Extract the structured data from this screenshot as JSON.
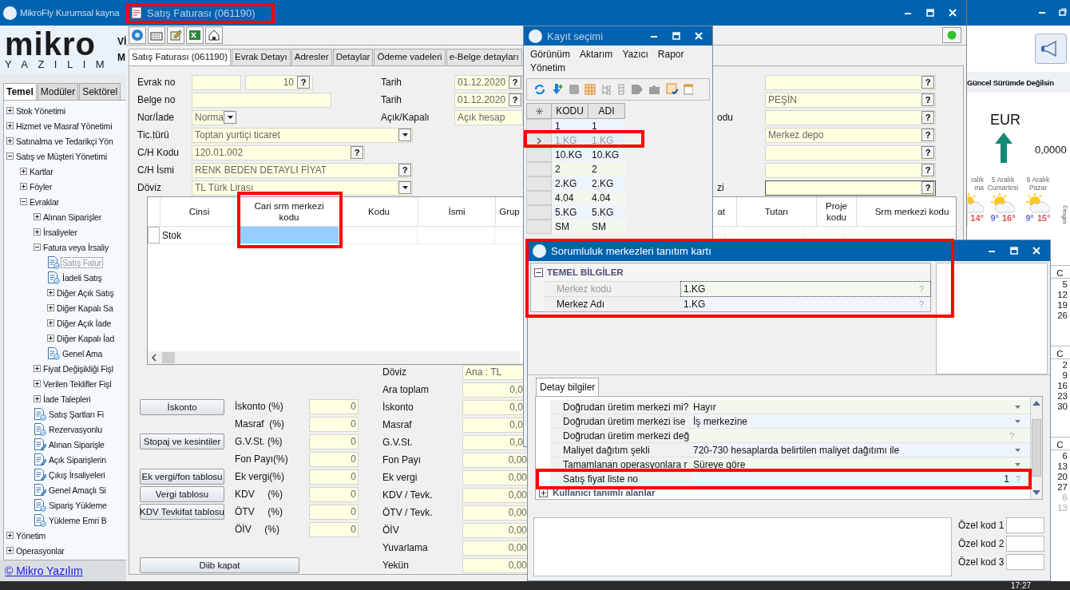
{
  "app": {
    "title": "MikroFly Kurumsal kayna",
    "logo": "mikro",
    "logo_sub": "YAZILIM",
    "logo_side": [
      "Vİ",
      "M"
    ],
    "footer_link": "© Mikro Yazılım"
  },
  "left_tabs": [
    {
      "label": "Temel",
      "selected": true
    },
    {
      "label": "Modüler",
      "selected": false
    },
    {
      "label": "Sektörel",
      "selected": false
    }
  ],
  "tree": [
    {
      "label": "Stok Yönetimi",
      "kind": "folder",
      "expanded": false,
      "selected": false
    },
    {
      "label": "Hizmet ve Masraf Yönetimi",
      "kind": "folder",
      "expanded": false,
      "selected": false
    },
    {
      "label": "Satınalma ve Tedarikçi Yön",
      "kind": "folder",
      "expanded": false,
      "selected": false
    },
    {
      "label": "Satış ve Müşteri Yönetimi",
      "kind": "folder",
      "expanded": true,
      "selected": false,
      "children": [
        {
          "label": "Kartlar",
          "kind": "folder",
          "expanded": false,
          "selected": false
        },
        {
          "label": "Föyler",
          "kind": "folder",
          "expanded": false,
          "selected": false
        },
        {
          "label": "Evraklar",
          "kind": "folder",
          "expanded": true,
          "selected": false,
          "children": [
            {
              "label": "Alınan Siparişler",
              "kind": "folder",
              "expanded": false,
              "selected": false
            },
            {
              "label": "İrsaliyeler",
              "kind": "folder",
              "expanded": false,
              "selected": false
            },
            {
              "label": "Fatura veya İrsaliy",
              "kind": "folder",
              "expanded": true,
              "selected": false,
              "children": [
                {
                  "label": "Satış Fatur",
                  "kind": "doc",
                  "selected": true
                },
                {
                  "label": "İadeli Satış",
                  "kind": "doc",
                  "selected": false
                },
                {
                  "label": "Diğer Açık Satış",
                  "kind": "folder",
                  "expanded": false,
                  "selected": false
                },
                {
                  "label": "Diğer Kapalı Sa",
                  "kind": "folder",
                  "expanded": false,
                  "selected": false
                },
                {
                  "label": "Diğer Açık İade",
                  "kind": "folder",
                  "expanded": false,
                  "selected": false
                },
                {
                  "label": "Diğer Kapalı İad",
                  "kind": "folder",
                  "expanded": false,
                  "selected": false
                },
                {
                  "label": "Genel Ama",
                  "kind": "doc",
                  "selected": false
                }
              ]
            },
            {
              "label": "Fiyat Değişikliği Fişl",
              "kind": "folder",
              "expanded": false,
              "selected": false
            },
            {
              "label": "Verilen Teklifler Fişl",
              "kind": "folder",
              "expanded": false,
              "selected": false
            },
            {
              "label": "İade Talepleri",
              "kind": "folder",
              "expanded": false,
              "selected": false
            },
            {
              "label": "Satış Şartları Fi",
              "kind": "doc",
              "selected": false
            },
            {
              "label": "Rezervasyonlu",
              "kind": "doc",
              "selected": false
            },
            {
              "label": "Alınan Siparişle",
              "kind": "doc-edit",
              "selected": false
            },
            {
              "label": "Açık Siparişlerin",
              "kind": "doc-edit",
              "selected": false
            },
            {
              "label": "Çıkış İrsaliyeleri",
              "kind": "doc-edit",
              "selected": false
            },
            {
              "label": "Genel Amaçlı Si",
              "kind": "doc-edit",
              "selected": false
            },
            {
              "label": "Sipariş Yükleme",
              "kind": "doc",
              "selected": false
            },
            {
              "label": "Yükleme Emri B",
              "kind": "doc",
              "selected": false
            }
          ]
        }
      ]
    },
    {
      "label": "Yönetim",
      "kind": "folder",
      "expanded": false,
      "selected": false
    },
    {
      "label": "Operasyonlar",
      "kind": "folder",
      "expanded": false,
      "selected": false
    }
  ],
  "invoice_window": {
    "title": "Satış Faturası (061190)",
    "tabs": [
      {
        "label": "Satış Faturası (061190)",
        "selected": true
      },
      {
        "label": "Evrak Detayı",
        "selected": false
      },
      {
        "label": "Adresler",
        "selected": false
      },
      {
        "label": "Detaylar",
        "selected": false
      },
      {
        "label": "Ödeme vadeleri",
        "selected": false
      },
      {
        "label": "e-Belge detayları",
        "selected": false
      }
    ],
    "fields_left": [
      {
        "label": "Evrak no",
        "kind": "serial",
        "value": "10",
        "button": "?"
      },
      {
        "label": "Belge no",
        "kind": "text"
      },
      {
        "label": "Nor/İade",
        "kind": "combo",
        "value": "Norma"
      },
      {
        "label": "Tic.türü",
        "kind": "combo",
        "value": "Toptan yurtiçi ticaret"
      },
      {
        "label": "C/H Kodu",
        "kind": "lookup",
        "value": "120.01.002",
        "button": "?"
      },
      {
        "label": "C/H İsmi",
        "kind": "lookup",
        "value": "RENK BEDEN DETAYLI FİYAT",
        "button": "?"
      },
      {
        "label": "Döviz",
        "kind": "combo",
        "value": "TL  Türk Lirası"
      }
    ],
    "fields_mid": [
      {
        "label": "Tarih",
        "kind": "lookup",
        "value": "01.12.2020",
        "button": "?"
      },
      {
        "label": "Tarih",
        "kind": "lookup",
        "value": "01.12.2020",
        "button": "?"
      },
      {
        "label": "Açık/Kapalı",
        "kind": "text",
        "value": "Açık hesap"
      }
    ],
    "fields_right": [
      {
        "kind": "lookup",
        "button": "?"
      },
      {
        "kind": "lookup",
        "value": "PEŞİN",
        "button": "?"
      },
      {
        "kind": "lookup",
        "label": "odu",
        "button": "?"
      },
      {
        "kind": "lookup",
        "value": "Merkez depo",
        "button": "?"
      },
      {
        "kind": "lookup",
        "button": "?"
      },
      {
        "kind": "lookup",
        "button": "?"
      },
      {
        "kind": "lookup",
        "label": "zi",
        "button": "?"
      }
    ],
    "grid": {
      "columns": [
        "Cinsi",
        "Cari srm merkezi kodu",
        "Kodu",
        "İsmi",
        "Grup",
        "at",
        "Tutarı",
        "Proje kodu",
        "Srm merkezi kodu"
      ],
      "rows": [
        {
          "cells": [
            {
              "text": "Stok",
              "selected": false
            },
            {
              "selected": true
            }
          ]
        }
      ]
    },
    "buttons": [
      "İskonto",
      "Stopaj ve kesintiler",
      "Ek vergi/fon tablosu",
      "Vergi tablosu",
      "KDV Tevkifat tablosu",
      "Diib kapat"
    ],
    "rates": [
      {
        "label": "İskonto (%)",
        "value": "0"
      },
      {
        "label": "Masraf  (%)",
        "value": "0"
      },
      {
        "label": "G.V.St. (%)",
        "value": "0"
      },
      {
        "label": "Fon Payı(%)",
        "value": "0"
      },
      {
        "label": "Ek vergi(%)",
        "value": "0"
      },
      {
        "label": "KDV     (%)",
        "value": "0"
      },
      {
        "label": "ÖTV     (%)",
        "value": "0"
      },
      {
        "label": "ÖİV     (%)",
        "value": "0"
      }
    ],
    "totals": [
      {
        "label": "Döviz",
        "kind": "text",
        "value": "Ana : TL"
      },
      {
        "label": "Ara toplam",
        "kind": "amount",
        "value": "0,0"
      },
      {
        "label": "İskonto",
        "kind": "amount",
        "value": "0,0"
      },
      {
        "label": "Masraf",
        "kind": "amount",
        "value": "0,0"
      },
      {
        "label": "G.V.St.",
        "kind": "amount",
        "value": "0,0"
      },
      {
        "label": "Fon Payı",
        "kind": "amount",
        "value": "0,00"
      },
      {
        "label": "Ek vergi",
        "kind": "amount",
        "value": "0,00"
      },
      {
        "label": "KDV / Tevk.",
        "kind": "amount",
        "value": "0,00"
      },
      {
        "label": "ÖTV / Tevk.",
        "kind": "amount",
        "value": "0,00"
      },
      {
        "label": "ÖİV",
        "kind": "amount",
        "value": "0,00"
      },
      {
        "label": "Yuvarlama",
        "kind": "amount",
        "value": "0,00"
      },
      {
        "label": "Yekün",
        "kind": "amount",
        "value": "0,00"
      }
    ]
  },
  "record_window": {
    "title": "Kayıt seçimi",
    "menu": [
      "Görünüm",
      "Aktarım",
      "Yazıcı",
      "Rapor",
      "Yönetim"
    ],
    "columns": [
      "KODU",
      "ADI"
    ],
    "rows": [
      {
        "code": "1",
        "name": "1",
        "selected": false
      },
      {
        "code": "1.KG",
        "name": "1.KG",
        "selected": true
      },
      {
        "code": "10.KG",
        "name": "10.KG",
        "selected": false
      },
      {
        "code": "2",
        "name": "2",
        "selected": false
      },
      {
        "code": "2.KG",
        "name": "2.KG",
        "selected": false
      },
      {
        "code": "4.04",
        "name": "4.04",
        "selected": false
      },
      {
        "code": "5.KG",
        "name": "5.KG",
        "selected": false
      },
      {
        "code": "SM",
        "name": "SM",
        "selected": false
      }
    ]
  },
  "center_window": {
    "title": "Sorumluluk merkezleri tanıtım kartı",
    "section": {
      "label": "TEMEL BİLGİLER",
      "expanded": true
    },
    "fields": [
      {
        "label": "Merkez kodu",
        "value": "1.KG",
        "button": "?",
        "disabled": true
      },
      {
        "label": "Merkez Adı",
        "value": "1.KG",
        "button": "?",
        "disabled": false
      }
    ],
    "detail_tab": "Detay bilgiler",
    "properties": [
      {
        "label": "Doğrudan üretim merkezi mi?",
        "kind": "combo",
        "value": "Hayır"
      },
      {
        "label": "Doğrudan üretim merkezi ise",
        "kind": "combo",
        "value": "İş merkezine"
      },
      {
        "label": "Doğrudan üretim merkezi değ",
        "kind": "lookup",
        "button": "?"
      },
      {
        "label": "Maliyet dağıtım şekli",
        "kind": "combo",
        "value": "720-730 hesaplarda belirtilen maliyet dağıtımı ile"
      },
      {
        "label": "Tamamlanan operasyonlara r",
        "kind": "combo",
        "value": "Süreye göre"
      },
      {
        "label": "Satış fiyat liste no",
        "kind": "number",
        "value": "1",
        "button": "?"
      }
    ],
    "custom_group": {
      "label": "Kullanıcı tanımlı alanlar",
      "expanded": false
    },
    "special_codes": [
      "Özel kod 1",
      "Özel kod 2",
      "Özel kod 3"
    ]
  },
  "desktop": {
    "update_banner": "Güncel Sürümde Değilsin",
    "currency": {
      "code": "EUR",
      "rate": "0,0000"
    },
    "weather": [
      {
        "day": "ralık",
        "sub": "ma",
        "high": "14°"
      },
      {
        "day": "5 Aralık",
        "sub": "Cumartesi",
        "low": "9°",
        "high": "16°"
      },
      {
        "day": "6 Aralık",
        "sub": "Pazar",
        "low": "9°",
        "high": "15°"
      }
    ],
    "weather_credit": "©mgm",
    "calendars": [
      {
        "header": "C",
        "days": [
          {
            "d": "5",
            "other": false
          },
          {
            "d": "12",
            "other": false
          },
          {
            "d": "19",
            "other": false
          },
          {
            "d": "26",
            "other": false
          }
        ]
      },
      {
        "header": "C",
        "days": [
          {
            "d": "2",
            "other": false
          },
          {
            "d": "9",
            "other": false
          },
          {
            "d": "16",
            "other": false
          },
          {
            "d": "23",
            "other": false
          },
          {
            "d": "30",
            "other": false
          }
        ]
      },
      {
        "header": "C",
        "days": [
          {
            "d": "6",
            "other": false
          },
          {
            "d": "13",
            "other": false
          },
          {
            "d": "20",
            "other": false
          },
          {
            "d": "27",
            "other": false
          },
          {
            "d": "6",
            "other": true
          },
          {
            "d": "13",
            "other": true
          }
        ]
      }
    ]
  },
  "taskbar": {
    "time": "17:27"
  }
}
